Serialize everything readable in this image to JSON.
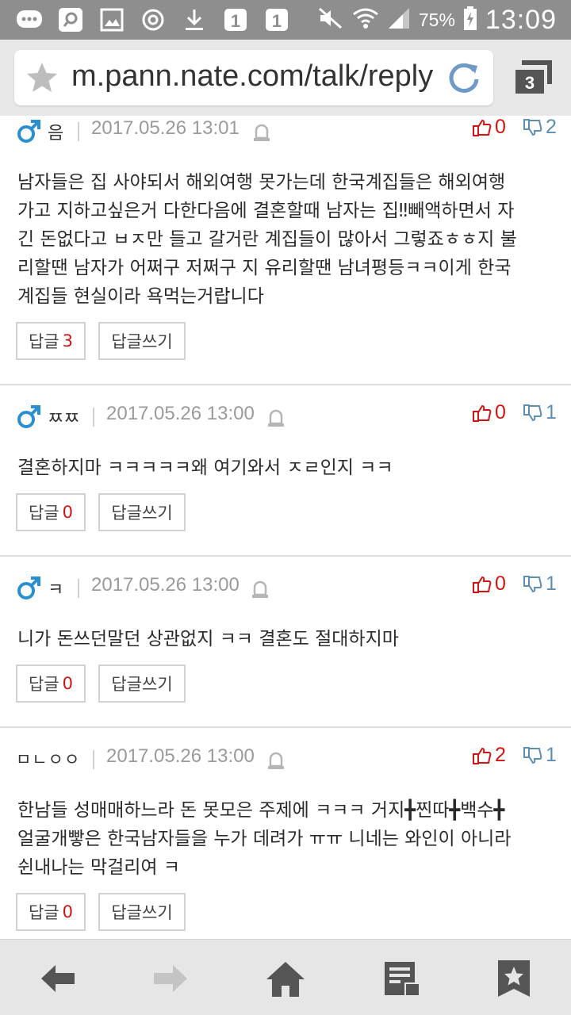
{
  "status_bar": {
    "battery": "75%",
    "time": "13:09",
    "left_icons": [
      "chat-icon",
      "search-app-icon",
      "image-icon",
      "sync-icon",
      "download-icon",
      "notification-one-icon",
      "notification-one-icon"
    ],
    "right_icons": [
      "mute-icon",
      "wifi-icon",
      "signal-icon",
      "battery-icon"
    ]
  },
  "browser": {
    "url": "m.pann.nate.com/talk/reply",
    "tab_count": "3"
  },
  "comments": [
    {
      "nickname": "음",
      "gender_icon": "male-icon",
      "date": "2017.05.26 13:01",
      "likes": "0",
      "dislikes": "2",
      "body": "남자들은 집 사야되서 해외여행 못가는데 한국계집들은 해외여행\n가고 지하고싶은거 다한다음에 결혼할때 남자는 집‼빼액하면서 자\n긴 돈없다고 ㅂㅈ만 들고 갈거란 계집들이 많아서 그렇죠ㅎㅎ지 불\n리할땐 남자가 어쩌구 저쩌구 지 유리할땐 남녀평등ㅋㅋ이게 한국\n계집들 현실이라 욕먹는거랍니다",
      "reply_label": "답글",
      "reply_count": "3",
      "write_label": "답글쓰기"
    },
    {
      "nickname": "ㅉㅉ",
      "gender_icon": "male-icon",
      "date": "2017.05.26 13:00",
      "likes": "0",
      "dislikes": "1",
      "body": "결혼하지마 ㅋㅋㅋㅋㅋ왜 여기와서 ㅈㄹ인지 ㅋㅋ",
      "reply_label": "답글",
      "reply_count": "0",
      "write_label": "답글쓰기"
    },
    {
      "nickname": "ㅋ",
      "gender_icon": "male-icon",
      "date": "2017.05.26 13:00",
      "likes": "0",
      "dislikes": "1",
      "body": "니가 돈쓰던말던 상관없지 ㅋㅋ 결혼도 절대하지마",
      "reply_label": "답글",
      "reply_count": "0",
      "write_label": "답글쓰기"
    },
    {
      "nickname": "ㅁㄴㅇㅇ",
      "gender_icon": "",
      "date": "2017.05.26 13:00",
      "likes": "2",
      "dislikes": "1",
      "body": "한남들 성매매하느라 돈 못모은 주제에 ㅋㅋㅋ 거지╋찐따╋백수╋\n얼굴개빻은 한국남자들을 누가 데려가 ㅠㅠ 니네는 와인이 아니라\n쉰내나는 막걸리여 ㅋ",
      "reply_label": "답글",
      "reply_count": "0",
      "write_label": "답글쓰기"
    }
  ],
  "toolbar": {
    "icons": [
      "back-arrow-icon",
      "forward-arrow-icon",
      "home-icon",
      "reading-list-icon",
      "bookmark-star-icon"
    ]
  },
  "colors": {
    "status_bar_bg": "#8e8e8e",
    "url_bar_bg": "#e8e8e8",
    "like_red": "#d01515",
    "dislike_blue": "#5d8fb3",
    "male_icon_blue": "#2a8fd0",
    "reload_blue": "#6f99c6"
  }
}
